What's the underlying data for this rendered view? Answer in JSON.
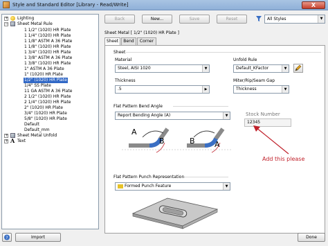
{
  "window": {
    "title": "Style and Standard Editor [Library - Read/Write]",
    "close_label": "X"
  },
  "tree": {
    "items": [
      {
        "label": "Lighting"
      },
      {
        "label": "Sheet Metal Rule"
      },
      {
        "label": "1 1/2\" (1020) HR Plate"
      },
      {
        "label": "1 1/4\" (1020) HR Plate"
      },
      {
        "label": "1 1/8\"  ASTM A 36 Plate"
      },
      {
        "label": "1 1/8\" (1020) HR Plate"
      },
      {
        "label": "1 3/4\" (1020) HR Plate"
      },
      {
        "label": "1 3/8\"  ASTM A 36 Plate"
      },
      {
        "label": "1 3/8\" (1020) HR Plate"
      },
      {
        "label": "1\"  ASTM A 36 Plate"
      },
      {
        "label": "1\" (1020) HR Plate"
      },
      {
        "label": "1/2\" (1020) HR Plate",
        "selected": true
      },
      {
        "label": "1/4\"  SS Plate"
      },
      {
        "label": "11 GA ASTM A 36 Plate"
      },
      {
        "label": "2 1/2\" (1020) HR Plate"
      },
      {
        "label": "2 1/4\" (1020) HR Plate"
      },
      {
        "label": "2\" (1020) HR Plate"
      },
      {
        "label": "3/4\" (1020) HR Plate"
      },
      {
        "label": "5/8\" (1020) HR Plate"
      },
      {
        "label": "Default"
      },
      {
        "label": "Default_mm"
      },
      {
        "label": "Sheet Metal Unfold"
      },
      {
        "label": "Text"
      }
    ]
  },
  "toolbar": {
    "back_label": "Back",
    "new_label": "New...",
    "save_label": "Save",
    "reset_label": "Reset",
    "filter_value": "All Styles"
  },
  "header": {
    "style_title": "Sheet Metal [ 1/2\" (1020) HR Plate ]"
  },
  "tabs": [
    {
      "label": "Sheet",
      "active": true
    },
    {
      "label": "Bend"
    },
    {
      "label": "Corner"
    }
  ],
  "sheet": {
    "section_label": "Sheet",
    "material_label": "Material",
    "material_value": "Steel, AISI 1020",
    "thickness_label": "Thickness",
    "thickness_value": ".5",
    "unfold_rule_label": "Unfold Rule",
    "unfold_rule_value": "Default_KFactor",
    "gap_label": "Miter/Rip/Seam Gap",
    "gap_value": "Thickness"
  },
  "flat_pattern": {
    "bend_angle_label": "Flat Pattern Bend Angle",
    "bend_angle_value": "Report Bending Angle (A)",
    "label_a1": "A",
    "label_b1": "B",
    "label_b2": "B",
    "label_a2": "A",
    "punch_label": "Flat Pattern Punch Representation",
    "punch_value": "Formed Punch Feature"
  },
  "stock_number": {
    "label": "Stock Number",
    "value": "12345"
  },
  "annotation": {
    "text": "Add this please",
    "color": "#c0202a"
  },
  "footer": {
    "import_label": "Import",
    "done_label": "Done"
  }
}
